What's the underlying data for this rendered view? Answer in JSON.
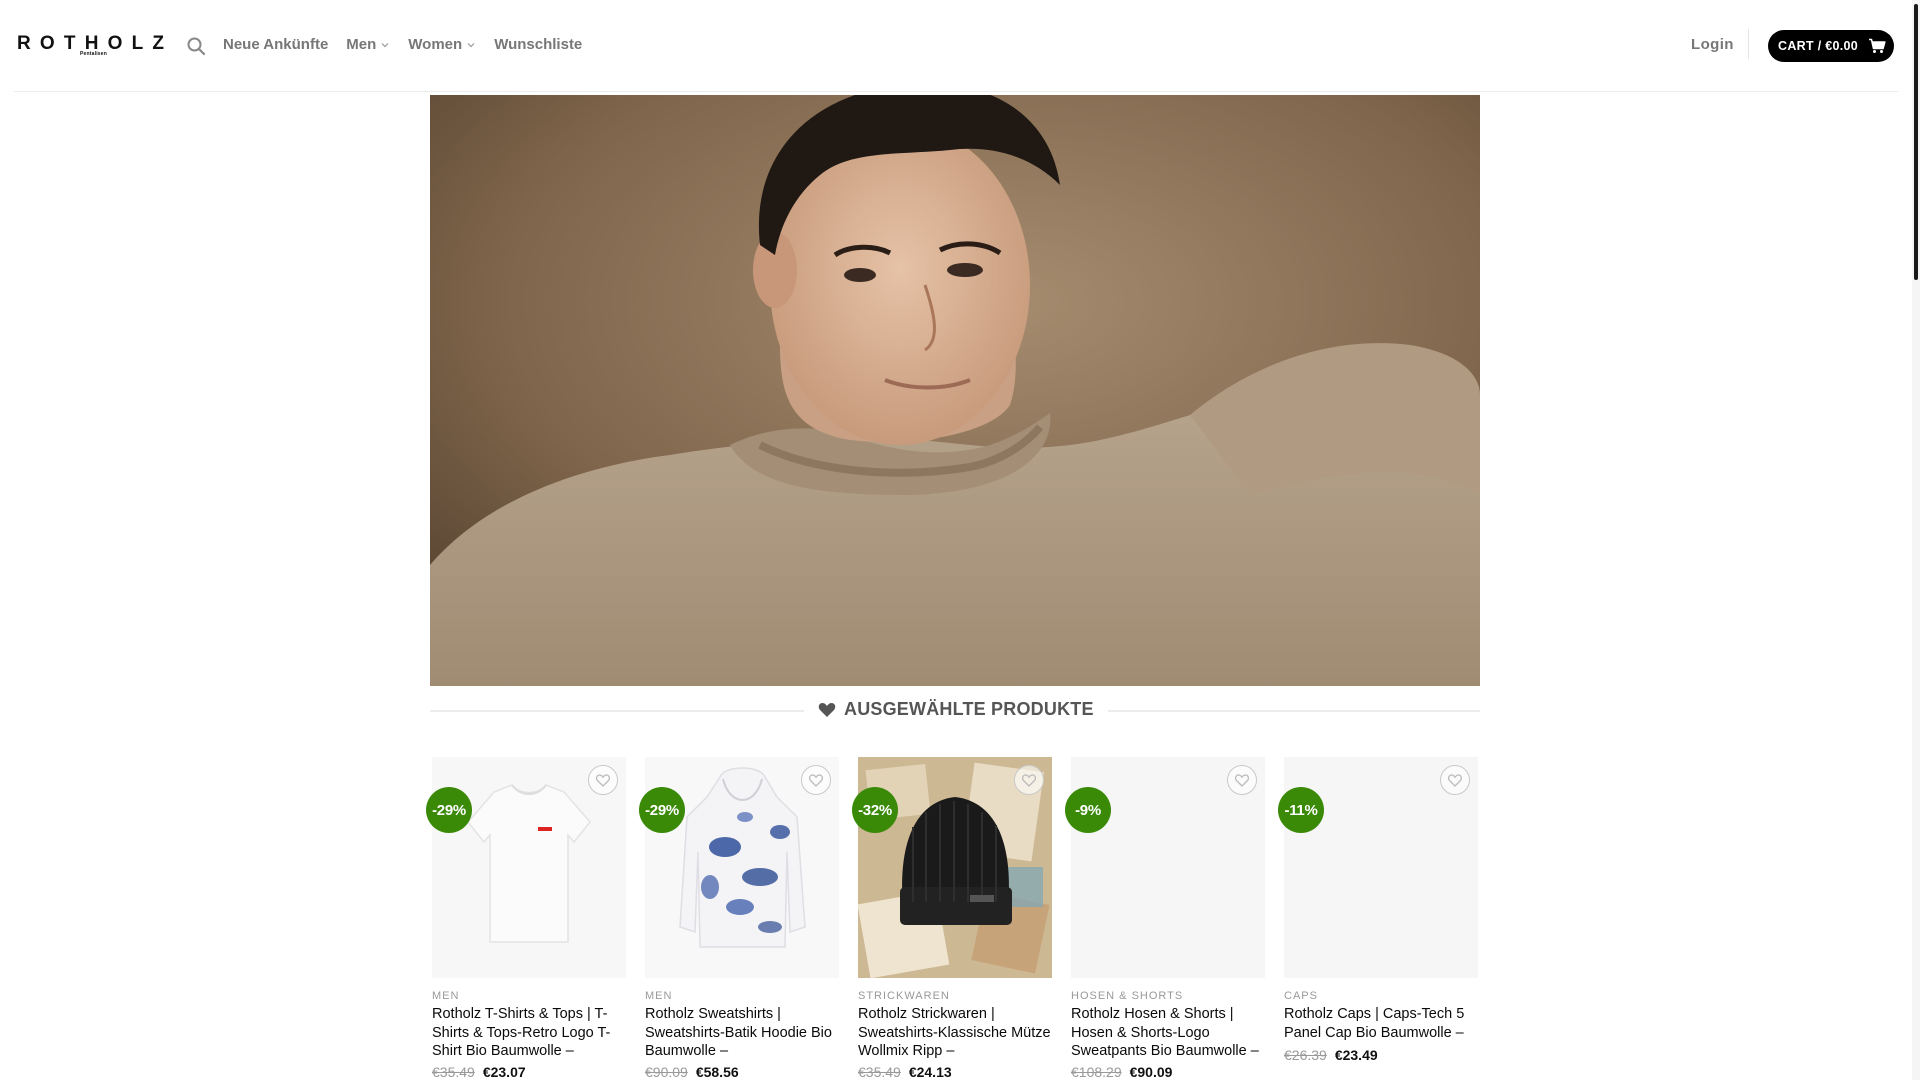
{
  "header": {
    "logo_text": "ROTHOLZ",
    "logo_subtext": "Pentalisen",
    "nav": [
      {
        "label": "Neue Ankünfte",
        "has_dropdown": false
      },
      {
        "label": "Men",
        "has_dropdown": true
      },
      {
        "label": "Women",
        "has_dropdown": true
      },
      {
        "label": "Wunschliste",
        "has_dropdown": false
      }
    ],
    "login_label": "Login",
    "cart_label": "CART / €0.00"
  },
  "section": {
    "title": "AUSGEWÄHLTE PRODUKTE",
    "icon": "heart-icon"
  },
  "products": [
    {
      "badge": "-29%",
      "category": "MEN",
      "name": "Rotholz T-Shirts & Tops | T-Shirts & Tops-Retro Logo T-Shirt Bio Baumwolle –",
      "old_price": "€35.49",
      "new_price": "€23.07",
      "image": "white-tshirt"
    },
    {
      "badge": "-29%",
      "category": "MEN",
      "name": "Rotholz Sweatshirts | Sweatshirts-Batik Hoodie Bio Baumwolle –",
      "old_price": "€90.09",
      "new_price": "€58.56",
      "image": "tie-dye-hoodie"
    },
    {
      "badge": "-32%",
      "category": "STRICKWAREN",
      "name": "Rotholz Strickwaren | Sweatshirts-Klassische Mütze Wollmix Ripp –",
      "old_price": "€35.49",
      "new_price": "€24.13",
      "image": "black-beanie"
    },
    {
      "badge": "-9%",
      "category": "HOSEN & SHORTS",
      "name": "Rotholz Hosen & Shorts | Hosen & Shorts-Logo Sweatpants Bio Baumwolle –",
      "old_price": "€108.29",
      "new_price": "€90.09",
      "image": "blank"
    },
    {
      "badge": "-11%",
      "category": "CAPS",
      "name": "Rotholz Caps | Caps-Tech 5 Panel Cap Bio Baumwolle –",
      "old_price": "€26.39",
      "new_price": "€23.49",
      "image": "blank"
    }
  ],
  "colors": {
    "badge_green": "#3a8a08",
    "cart_bg": "#000000",
    "nav_text": "#777777"
  }
}
